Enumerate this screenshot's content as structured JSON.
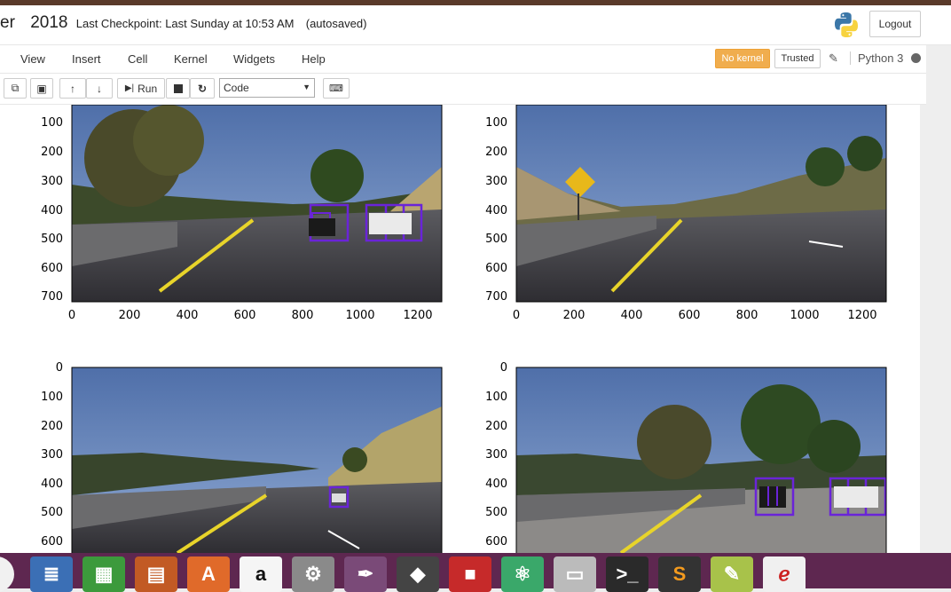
{
  "header": {
    "name_fragment": "er",
    "title": "2018",
    "checkpoint": "Last Checkpoint: Last Sunday at 10:53 AM",
    "autosaved": "(autosaved)",
    "logout": "Logout"
  },
  "menu": [
    "View",
    "Insert",
    "Cell",
    "Kernel",
    "Widgets",
    "Help"
  ],
  "kernel": {
    "status": "No kernel",
    "trusted": "Trusted",
    "name": "Python 3"
  },
  "toolbar": {
    "run": "Run",
    "cell_type": "Code"
  },
  "plots": [
    {
      "y_ticks": [
        "100",
        "200",
        "300",
        "400",
        "500",
        "600",
        "700"
      ],
      "x_ticks": [
        "0",
        "200",
        "400",
        "600",
        "800",
        "1000",
        "1200"
      ],
      "scene": "trees-car-left",
      "detections": 2
    },
    {
      "y_ticks": [
        "100",
        "200",
        "300",
        "400",
        "500",
        "600",
        "700"
      ],
      "x_ticks": [
        "0",
        "200",
        "400",
        "600",
        "800",
        "1000",
        "1200"
      ],
      "scene": "deer-sign",
      "detections": 0
    },
    {
      "y_ticks": [
        "0",
        "100",
        "200",
        "300",
        "400",
        "500",
        "600"
      ],
      "x_ticks": [],
      "scene": "hill-right",
      "detections": 1
    },
    {
      "y_ticks": [
        "0",
        "100",
        "200",
        "300",
        "400",
        "500",
        "600"
      ],
      "x_ticks": [],
      "scene": "trees-two-cars",
      "detections": 2
    }
  ],
  "taskbar": [
    "chrome-icon",
    "writer-icon",
    "calc-icon",
    "impress-icon",
    "software-center-icon",
    "amazon-icon",
    "settings-icon",
    "inkscape-pen-icon",
    "inkscape-icon",
    "office-icon",
    "atom-icon",
    "drive-icon",
    "terminal-icon",
    "sublime-icon",
    "gedit-icon",
    "evince-icon"
  ]
}
